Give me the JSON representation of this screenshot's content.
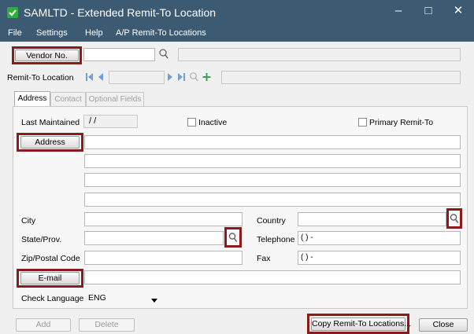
{
  "window": {
    "title": "SAMLTD - Extended Remit-To Location",
    "minimize_glyph": "–",
    "maximize_glyph": "□",
    "close_glyph": "✕"
  },
  "menu": {
    "file": "File",
    "settings": "Settings",
    "help": "Help",
    "remit_locations": "A/P Remit-To Locations"
  },
  "vendor": {
    "button_label": "Vendor No.",
    "value": "",
    "description": ""
  },
  "remit_to": {
    "label": "Remit-To Location",
    "value": "",
    "description": ""
  },
  "tabs": [
    "Address",
    "Contact",
    "Optional Fields"
  ],
  "form": {
    "last_maintained_label": "Last Maintained",
    "last_maintained_value": " /  /",
    "inactive_label": "Inactive",
    "primary_label": "Primary Remit-To",
    "address_button": "Address",
    "city_label": "City",
    "country_label": "Country",
    "state_label": "State/Prov.",
    "telephone_label": "Telephone",
    "telephone_value": "(   )   -",
    "zip_label": "Zip/Postal Code",
    "fax_label": "Fax",
    "fax_value": "(   )   -",
    "email_button": "E-mail",
    "check_language_label": "Check Language",
    "check_language_value": "ENG"
  },
  "footer": {
    "add": "Add",
    "delete": "Delete",
    "copy": "Copy Remit-To Locations...",
    "close": "Close"
  },
  "colors": {
    "titlebar": "#3d5a73",
    "highlight": "#8b1a1a",
    "app_icon": "#2fae3b"
  }
}
